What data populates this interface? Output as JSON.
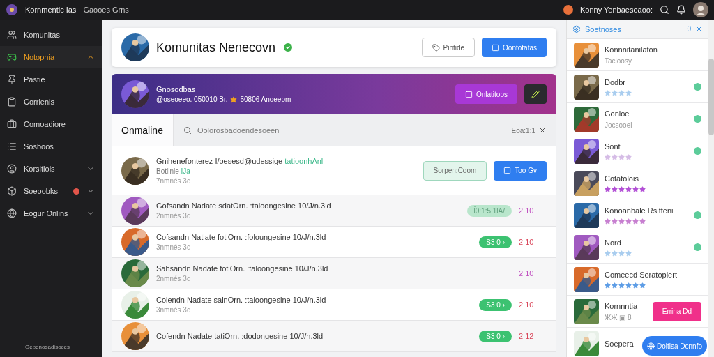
{
  "top_bar": {
    "app_title": "Kornmentic Ias",
    "section": "Gaooes Grns",
    "user_name": "Konny Yenbaesoaoo:"
  },
  "sidebar": {
    "items": [
      {
        "label": "Komunitas",
        "kind": "plain",
        "selected": false,
        "alert": false
      },
      {
        "label": "Notopnia",
        "kind": "group",
        "selected": true,
        "expanded": true,
        "alert": false
      },
      {
        "label": "Pastie",
        "kind": "plain",
        "selected": false,
        "alert": false
      },
      {
        "label": "Corrienis",
        "kind": "plain",
        "selected": false,
        "alert": false
      },
      {
        "label": "Comoadiore",
        "kind": "plain",
        "selected": false,
        "alert": false
      },
      {
        "label": "Sosboos",
        "kind": "plain",
        "selected": false,
        "alert": false
      },
      {
        "label": "Korsitiols",
        "kind": "group",
        "selected": false,
        "expanded": false,
        "alert": false
      },
      {
        "label": "Soeoobks",
        "kind": "group",
        "selected": false,
        "expanded": false,
        "alert": true
      },
      {
        "label": "Eogur Onlins",
        "kind": "group",
        "selected": false,
        "expanded": false,
        "alert": false
      }
    ],
    "footer": "Oepenosadisoces"
  },
  "header": {
    "title": "Komunitas Nenecovn",
    "verified": true,
    "buttons": [
      {
        "label": "Pintide",
        "kind": "outline"
      },
      {
        "label": "Oontotatas",
        "kind": "primary"
      }
    ]
  },
  "banner": {
    "name": "Gnosodbas",
    "stats": "@oseoeeo. 050010 Br.",
    "rating": "50806 Anoeeom",
    "button": "Onlatitoos"
  },
  "tabs": [
    {
      "label": "Onmaline",
      "selected": true
    }
  ],
  "search": {
    "placeholder": "Oolorosbadoendesoeen"
  },
  "filter": "Eoa:1:1",
  "featured": {
    "title": "Gnihenefonterez I/oesesd@udessige",
    "title_link": "tatioonhAnl",
    "subtitle": "Botlinle",
    "subtitle_link": "IJa",
    "time": "7nmnés 3d",
    "buttons": [
      {
        "label": "Sorpen:Coom",
        "kind": "soft"
      },
      {
        "label": "Too Gv",
        "kind": "primary"
      }
    ]
  },
  "posts": [
    {
      "title": "Gofsandn Nadate sdatOrn. :taloongesine 10/J/n.3ld",
      "time": "2nmnés 3d",
      "badge": "ĺ0:1:5 1lA/",
      "muted": true,
      "count": "2 10",
      "color": "#c04fc0"
    },
    {
      "title": "Cofsandn Natlate fotiOrn. :foloungesine 10/J/n.3ld",
      "time": "3nmnés 3d",
      "badge": "S3 0 ›",
      "muted": false,
      "count": "2 10",
      "color": "#d9465a"
    },
    {
      "title": "Sahsandn Nadate fotiOrn. :taloongesine 10/J/n.3ld",
      "time": "2nmnés 3d",
      "count": "2 10",
      "color": "#c04fc0"
    },
    {
      "title": "Colendn Nadate sainOrn. :taloongesine 10/J/n.3ld",
      "time": "3nmnés 3d",
      "badge": "S3 0 ›",
      "muted": false,
      "count": "2 10",
      "color": "#d9465a"
    },
    {
      "title": "Cofendn Nadate tatiOrn. :dodongesine 10/J/n.3ld",
      "badge": "S3 0 ›",
      "muted": false,
      "count": "2 12",
      "color": "#d9465a"
    }
  ],
  "right_panel": {
    "title": "Soetnoses",
    "count": "0",
    "items": [
      {
        "name": "Konnnitanilaton",
        "kind": "text",
        "subtitle": "Tacioosy",
        "online": false
      },
      {
        "name": "Dodbr",
        "kind": "stars",
        "stars": 4,
        "color": "#a9cdef",
        "online": true
      },
      {
        "name": "Gonloe",
        "kind": "text",
        "subtitle": "Jocsooel",
        "online": true
      },
      {
        "name": "Sont",
        "kind": "stars",
        "stars": 4,
        "color": "#d5bce6",
        "online": true
      },
      {
        "name": "Cotatolois",
        "kind": "stars",
        "stars": 6,
        "color": "#b24fd6",
        "online": false
      },
      {
        "name": "Konoanbale Rsitteni",
        "kind": "stars",
        "stars": 6,
        "color": "#c77fd0",
        "online": true
      },
      {
        "name": "Nord",
        "kind": "stars",
        "stars": 4,
        "color": "#a9cdef",
        "online": true
      },
      {
        "name": "Comeecd Soratopiert",
        "kind": "stars",
        "stars": 6,
        "color": "#5d9de6",
        "online": false
      },
      {
        "name": "Kornnntia",
        "kind": "text",
        "subtitle": "ЖЖ ▣ 8",
        "online": false,
        "button": "Errina Dd"
      },
      {
        "name": "Soepera",
        "kind": "text"
      }
    ],
    "floating_button": "Doltisa Dcnnfo"
  }
}
